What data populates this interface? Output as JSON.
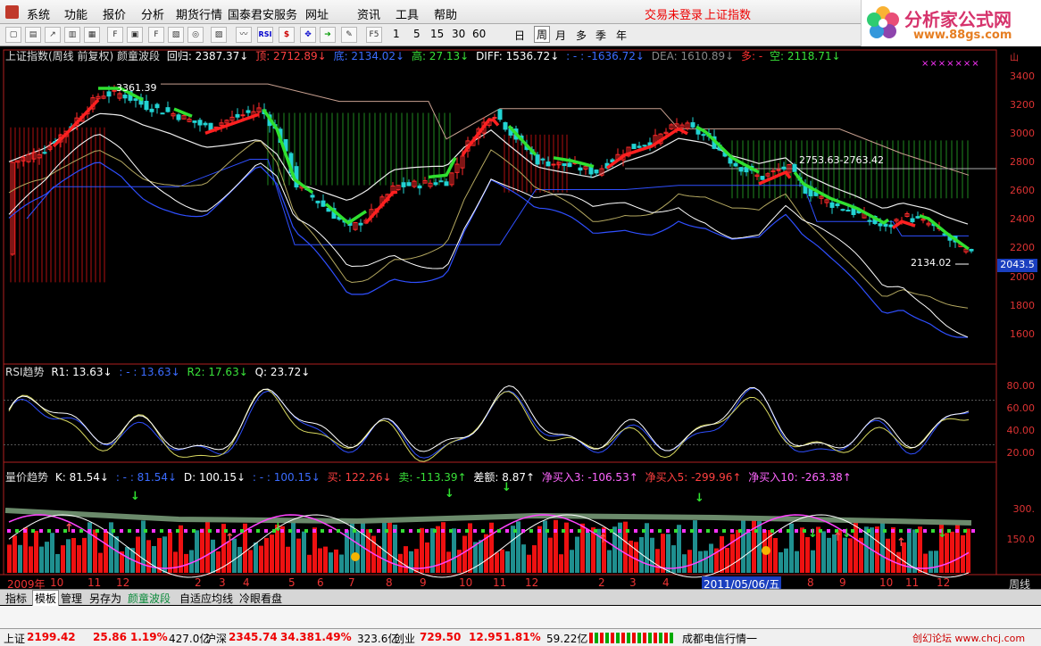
{
  "menu": {
    "items": [
      "系统",
      "功能",
      "报价",
      "分析",
      "期货行情",
      "国泰君安服务",
      "网址",
      "资讯",
      "工具",
      "帮助"
    ],
    "keys": [
      "",
      "",
      "",
      "",
      "",
      "",
      "",
      "",
      "",
      ""
    ],
    "trade_status": "交易未登录",
    "index_name": "上证指数"
  },
  "logo": {
    "title": "分析家公式网",
    "url": "www.88gs.com"
  },
  "toolbar": {
    "icon_labels": [
      "RSI",
      "$"
    ],
    "periods": [
      "F5",
      "1",
      "5",
      "15",
      "30",
      "60",
      "日",
      "周",
      "月",
      "多",
      "季",
      "年"
    ],
    "active_period": "周"
  },
  "main_panel": {
    "title": "上证指数(周线 前复权) 颜童波段",
    "items": [
      {
        "t": "回归: 2387.37↓",
        "c": "#ffffff"
      },
      {
        "t": "顶: 2712.89↓",
        "c": "#ff4040"
      },
      {
        "t": "底: 2134.02↓",
        "c": "#3b6cff"
      },
      {
        "t": "高: 27.13↓",
        "c": "#39e039"
      },
      {
        "t": "DIFF: 1536.72↓",
        "c": "#ffffff"
      },
      {
        "t": ": - : -1636.72↓",
        "c": "#3b6cff"
      },
      {
        "t": "DEA: 1610.89↓",
        "c": "#888888"
      },
      {
        "t": "多: -",
        "c": "#ff3030"
      },
      {
        "t": "空: 2118.71↓",
        "c": "#39e039"
      }
    ],
    "y_ticks": [
      "3400",
      "3200",
      "3000",
      "2800",
      "2600",
      "2400",
      "2200",
      "2000",
      "1800",
      "1600"
    ],
    "annotations": {
      "high": "3361.39",
      "range": "2753.63-2763.42",
      "low": "2134.02",
      "last_price": "2043.5",
      "tag": "山"
    }
  },
  "rsi_panel": {
    "items": [
      {
        "t": "RSI趋势",
        "c": "#dddddd"
      },
      {
        "t": "R1: 13.63↓",
        "c": "#ffffff"
      },
      {
        "t": ": - : 13.63↓",
        "c": "#3b6cff"
      },
      {
        "t": "R2: 17.63↓",
        "c": "#39e039"
      },
      {
        "t": "Q: 23.72↓",
        "c": "#ffffff"
      }
    ],
    "y_ticks": [
      "80.00",
      "60.00",
      "40.00",
      "20.00"
    ]
  },
  "vol_panel": {
    "items": [
      {
        "t": "量价趋势",
        "c": "#dddddd"
      },
      {
        "t": "K: 81.54↓",
        "c": "#ffffff"
      },
      {
        "t": ": - : 81.54↓",
        "c": "#3b6cff"
      },
      {
        "t": "D: 100.15↓",
        "c": "#ffffff"
      },
      {
        "t": ": - : 100.15↓",
        "c": "#3b6cff"
      },
      {
        "t": "买: 122.26↓",
        "c": "#ff4040"
      },
      {
        "t": "卖: -113.39↑",
        "c": "#39e039"
      },
      {
        "t": "差额: 8.87↑",
        "c": "#ffffff"
      },
      {
        "t": "净买入3: -106.53↑",
        "c": "#ff66ff"
      },
      {
        "t": "净买入5: -299.96↑",
        "c": "#ff4040"
      },
      {
        "t": "净买入10: -263.38↑",
        "c": "#ff66ff"
      }
    ],
    "y_ticks": [
      "300.",
      "150.0"
    ]
  },
  "x_axis": {
    "labels": [
      "2009年",
      "10",
      "11",
      "12",
      "2",
      "3",
      "4",
      "5",
      "6",
      "7",
      "8",
      "9",
      "10",
      "11",
      "12",
      "2",
      "3",
      "4",
      "2011/05/06/五",
      "8",
      "9",
      "10",
      "11",
      "12"
    ],
    "period_label": "周线"
  },
  "tabs": [
    "指标",
    "模板",
    "管理",
    "另存为",
    "颜童波段",
    "自适应均线",
    "冷眼看盘"
  ],
  "active_tab": "模板",
  "status": {
    "sh_label": "上证",
    "sh_value": "2199.42",
    "sh_change": "25.86",
    "sh_pct": "1.19%",
    "sh_amount": "427.0亿",
    "hs_label": "沪深",
    "hs_value": "2345.74",
    "hs_change": "34.38",
    "hs_pct": "1.49%",
    "hs_amount": "323.6亿",
    "cy_label": "创业",
    "cy_value": "729.50",
    "cy_change": "12.95",
    "cy_pct": "1.81%",
    "cy_amount": "59.22亿",
    "market_info": "成都电信行情一",
    "watermark": "创幻论坛 www.chcj.com"
  },
  "colors": {
    "up": "#ff2a2a",
    "down": "#22d3d3",
    "green": "#39e039",
    "blue": "#3b6cff",
    "axis": "#c02020"
  }
}
